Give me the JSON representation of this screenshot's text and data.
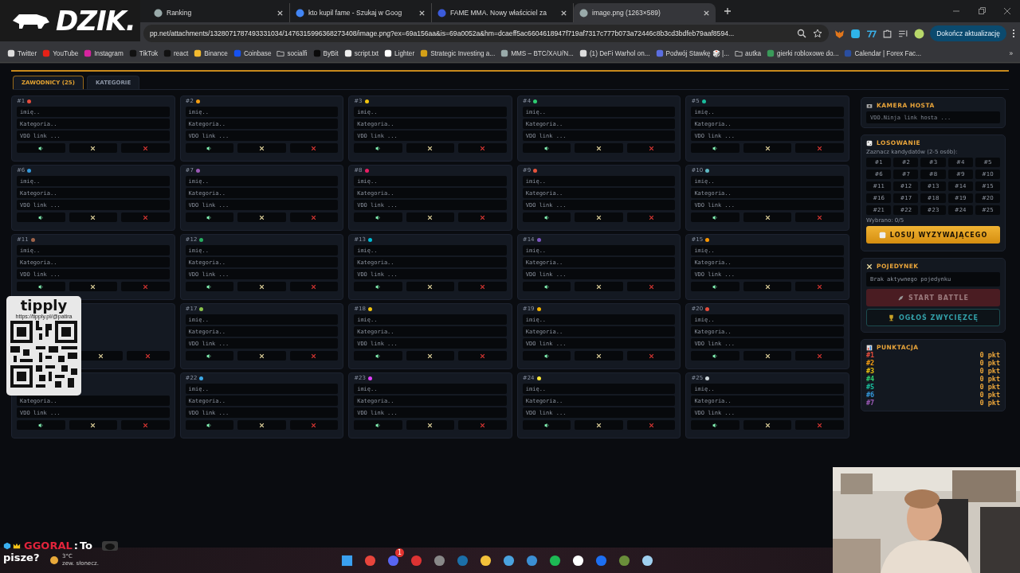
{
  "browser": {
    "tabs": [
      {
        "title": "Ranking",
        "selected": false
      },
      {
        "title": "kto kupil fame - Szukaj w Goog",
        "selected": false
      },
      {
        "title": "FAME MMA. Nowy właściciel za",
        "selected": false
      },
      {
        "title": "image.png (1263×589)",
        "selected": true
      }
    ],
    "address": "pp.net/attachments/1328071787493331034/1476315996368273408/image.png?ex=69a156aa&is=69a0052a&hm=dcaeff5ac6604618947f719af7317c777b073a72446c8b3cd3bdfeb79aaf8594...",
    "update_button": "Dokończ aktualizację",
    "bookmarks": [
      {
        "label": "Twitter"
      },
      {
        "label": "YouTube"
      },
      {
        "label": "Instagram"
      },
      {
        "label": "TikTok"
      },
      {
        "label": "react"
      },
      {
        "label": "Binance"
      },
      {
        "label": "Coinbase"
      },
      {
        "label": "socialfi",
        "kind": "folder"
      },
      {
        "label": "ByBit"
      },
      {
        "label": "script.txt"
      },
      {
        "label": "Lighter"
      },
      {
        "label": "Strategic Investing a..."
      },
      {
        "label": "MMS – BTC/XAU/N..."
      },
      {
        "label": "(1) DeFi Warhol on..."
      },
      {
        "label": "Podwój Stawkę 🎲 |..."
      },
      {
        "label": "autka",
        "kind": "folder"
      },
      {
        "label": "gierki robloxowe do..."
      },
      {
        "label": "Calendar | Forex Fac..."
      }
    ],
    "more": "»"
  },
  "app": {
    "tabs": [
      {
        "label": "ZAWODNICY (25)",
        "selected": true
      },
      {
        "label": "KATEGORIE",
        "selected": false
      }
    ],
    "fighters": [
      {
        "kind": "card",
        "number": "#1",
        "color": "#e74c3c",
        "fields": [
          {
            "placeholder": "imię.."
          },
          {
            "placeholder": "Kategoria.."
          },
          {
            "placeholder": "VDO link ..."
          }
        ]
      },
      {
        "kind": "card",
        "number": "#2",
        "color": "#f39c12",
        "fields": [
          {
            "placeholder": "imię.."
          },
          {
            "placeholder": "Kategoria.."
          },
          {
            "placeholder": "VDO link ..."
          }
        ]
      },
      {
        "kind": "card",
        "number": "#3",
        "color": "#f1c40f",
        "fields": [
          {
            "placeholder": "imię.."
          },
          {
            "placeholder": "Kategoria.."
          },
          {
            "placeholder": "VDO link ..."
          }
        ]
      },
      {
        "kind": "card",
        "number": "#4",
        "color": "#2ecc71",
        "fields": [
          {
            "placeholder": "imię.."
          },
          {
            "placeholder": "Kategoria.."
          },
          {
            "placeholder": "VDO link ..."
          }
        ]
      },
      {
        "kind": "card",
        "number": "#5",
        "color": "#1abc9c",
        "fields": [
          {
            "placeholder": "imię.."
          },
          {
            "placeholder": "Kategoria.."
          },
          {
            "placeholder": "VDO link ..."
          }
        ]
      },
      {
        "kind": "card",
        "number": "#6",
        "color": "#3498db",
        "fields": [
          {
            "placeholder": "imię.."
          },
          {
            "placeholder": "Kategoria.."
          },
          {
            "placeholder": "VDO link ..."
          }
        ]
      },
      {
        "kind": "card",
        "number": "#7",
        "color": "#9b59b6",
        "fields": [
          {
            "placeholder": "imię.."
          },
          {
            "placeholder": "Kategoria.."
          },
          {
            "placeholder": "VDO link ..."
          }
        ]
      },
      {
        "kind": "card",
        "number": "#8",
        "color": "#e91e63",
        "fields": [
          {
            "placeholder": "imię.."
          },
          {
            "placeholder": "Kategoria.."
          },
          {
            "placeholder": "VDO link ..."
          }
        ]
      },
      {
        "kind": "card",
        "number": "#9",
        "color": "#e8543c",
        "fields": [
          {
            "placeholder": "imię.."
          },
          {
            "placeholder": "Kategoria.."
          },
          {
            "placeholder": "VDO link ..."
          }
        ]
      },
      {
        "kind": "card",
        "number": "#10",
        "color": "#5fb8c4",
        "fields": [
          {
            "placeholder": "imię.."
          },
          {
            "placeholder": "Kategoria.."
          },
          {
            "placeholder": "VDO link ..."
          }
        ]
      },
      {
        "kind": "card",
        "number": "#11",
        "color": "#a0644a",
        "fields": [
          {
            "placeholder": "imię.."
          },
          {
            "placeholder": "Kategoria.."
          },
          {
            "placeholder": "VDO link ..."
          }
        ]
      },
      {
        "kind": "card",
        "number": "#12",
        "color": "#27ae60",
        "fields": [
          {
            "placeholder": "imię.."
          },
          {
            "placeholder": "Kategoria.."
          },
          {
            "placeholder": "VDO link ..."
          }
        ]
      },
      {
        "kind": "card",
        "number": "#13",
        "color": "#00bcd4",
        "fields": [
          {
            "placeholder": "imię.."
          },
          {
            "placeholder": "Kategoria.."
          },
          {
            "placeholder": "VDO link ..."
          }
        ]
      },
      {
        "kind": "card",
        "number": "#14",
        "color": "#7e57c2",
        "fields": [
          {
            "placeholder": "imię.."
          },
          {
            "placeholder": "Kategoria.."
          },
          {
            "placeholder": "VDO link ..."
          }
        ]
      },
      {
        "kind": "card",
        "number": "#15",
        "color": "#ff9800",
        "fields": [
          {
            "placeholder": "imię.."
          },
          {
            "placeholder": "Kategoria.."
          },
          {
            "placeholder": "VDO link ..."
          }
        ]
      },
      {
        "kind": "covered"
      },
      {
        "kind": "card",
        "number": "#17",
        "color": "#8bc34a",
        "fields": [
          {
            "placeholder": "imię.."
          },
          {
            "placeholder": "Kategoria.."
          },
          {
            "placeholder": "VDO link ..."
          }
        ]
      },
      {
        "kind": "card",
        "number": "#18",
        "color": "#f1c40f",
        "fields": [
          {
            "placeholder": "imię.."
          },
          {
            "placeholder": "Kategoria.."
          },
          {
            "placeholder": "VDO link ..."
          }
        ]
      },
      {
        "kind": "card",
        "number": "#19",
        "color": "#f5b400",
        "fields": [
          {
            "placeholder": "imię.."
          },
          {
            "placeholder": "Kategoria.."
          },
          {
            "placeholder": "VDO link ..."
          }
        ]
      },
      {
        "kind": "card",
        "number": "#20",
        "color": "#e74c3c",
        "fields": [
          {
            "placeholder": "imię.."
          },
          {
            "placeholder": "Kategoria.."
          },
          {
            "placeholder": "VDO link ..."
          }
        ]
      },
      {
        "kind": "card",
        "fields": [
          {
            "placeholder": "Kategoria.."
          },
          {
            "placeholder": "VDO link ..."
          }
        ]
      },
      {
        "kind": "card",
        "number": "#22",
        "color": "#3ca9e8",
        "fields": [
          {
            "placeholder": "imię.."
          },
          {
            "placeholder": "Kategoria.."
          },
          {
            "placeholder": "VDO link ..."
          }
        ]
      },
      {
        "kind": "card",
        "number": "#23",
        "color": "#e040fb",
        "fields": [
          {
            "placeholder": "imię.."
          },
          {
            "placeholder": "Kategoria.."
          },
          {
            "placeholder": "VDO link ..."
          }
        ]
      },
      {
        "kind": "card",
        "number": "#24",
        "color": "#ffeb3b",
        "fields": [
          {
            "placeholder": "imię.."
          },
          {
            "placeholder": "Kategoria.."
          },
          {
            "placeholder": "VDO link ..."
          }
        ]
      },
      {
        "kind": "card",
        "number": "#25",
        "color": "#cfd8dc",
        "fields": [
          {
            "placeholder": "imię.."
          },
          {
            "placeholder": "Kategoria.."
          },
          {
            "placeholder": "VDO link ..."
          }
        ]
      }
    ],
    "host_camera": {
      "title": "KAMERA HOSTA",
      "placeholder": "VDO.Ninja link hosta ..."
    },
    "draw": {
      "title": "LOSOWANIE",
      "hint": "Zaznacz kandydatów (2-5 osób):",
      "candidates": [
        {
          "label": "#1",
          "selected": false
        },
        {
          "label": "#2",
          "selected": false
        },
        {
          "label": "#3",
          "selected": false
        },
        {
          "label": "#4",
          "selected": false
        },
        {
          "label": "#5",
          "selected": false
        },
        {
          "label": "#6",
          "selected": false
        },
        {
          "label": "#7",
          "selected": false
        },
        {
          "label": "#8",
          "selected": false
        },
        {
          "label": "#9",
          "selected": false
        },
        {
          "label": "#10",
          "selected": false
        },
        {
          "label": "#11",
          "selected": false
        },
        {
          "label": "#12",
          "selected": false
        },
        {
          "label": "#13",
          "selected": false
        },
        {
          "label": "#14",
          "selected": false
        },
        {
          "label": "#15",
          "selected": false
        },
        {
          "label": "#16",
          "selected": false
        },
        {
          "label": "#17",
          "selected": false
        },
        {
          "label": "#18",
          "selected": false
        },
        {
          "label": "#19",
          "selected": false
        },
        {
          "label": "#20",
          "selected": false
        },
        {
          "label": "#21",
          "selected": false
        },
        {
          "label": "#22",
          "selected": false
        },
        {
          "label": "#23",
          "selected": false
        },
        {
          "label": "#24",
          "selected": false
        },
        {
          "label": "#25",
          "selected": false
        }
      ],
      "count": "Wybrano: 0/5",
      "button": "LOSUJ WYZYWAJĄCEGO"
    },
    "duel": {
      "title": "POJEDYNEK",
      "status": "Brak aktywnego pojedynku",
      "start_button": "START BATTLE",
      "start_disabled": true,
      "winner_button": "OGŁOŚ ZWYCIĘZCĘ"
    },
    "scores": {
      "title": "PUNKTACJA",
      "rows": [
        {
          "label": "#1",
          "color": "#e74c3c",
          "points": "0 pkt"
        },
        {
          "label": "#2",
          "color": "#f39c12",
          "points": "0 pkt"
        },
        {
          "label": "#3",
          "color": "#f1c40f",
          "points": "0 pkt"
        },
        {
          "label": "#4",
          "color": "#2ecc71",
          "points": "0 pkt"
        },
        {
          "label": "#5",
          "color": "#1abc9c",
          "points": "0 pkt"
        },
        {
          "label": "#6",
          "color": "#3498db",
          "points": "0 pkt"
        },
        {
          "label": "#7",
          "color": "#9b59b6",
          "points": "0 pkt"
        }
      ]
    }
  },
  "overlays": {
    "logo": "DZIK.",
    "tip": {
      "brand": "tipply",
      "url": "https://tipply.pl/@patira"
    },
    "chat": {
      "user": "GGORAL",
      "separator": ":",
      "message": "To",
      "message_2": "pisze?"
    }
  },
  "taskbar": {
    "temperature": "3°C",
    "weather": "zew. słonecz.",
    "apps": [
      {
        "kind": "start"
      },
      {
        "kind": "browser"
      },
      {
        "kind": "chat",
        "badge": "1"
      },
      {
        "kind": "snip"
      },
      {
        "kind": "record"
      },
      {
        "kind": "steam"
      },
      {
        "kind": "folder"
      },
      {
        "kind": "c"
      },
      {
        "kind": "tool"
      },
      {
        "kind": "music"
      },
      {
        "kind": "mountain"
      },
      {
        "kind": "xapp"
      },
      {
        "kind": "game"
      },
      {
        "kind": "notes"
      }
    ]
  }
}
